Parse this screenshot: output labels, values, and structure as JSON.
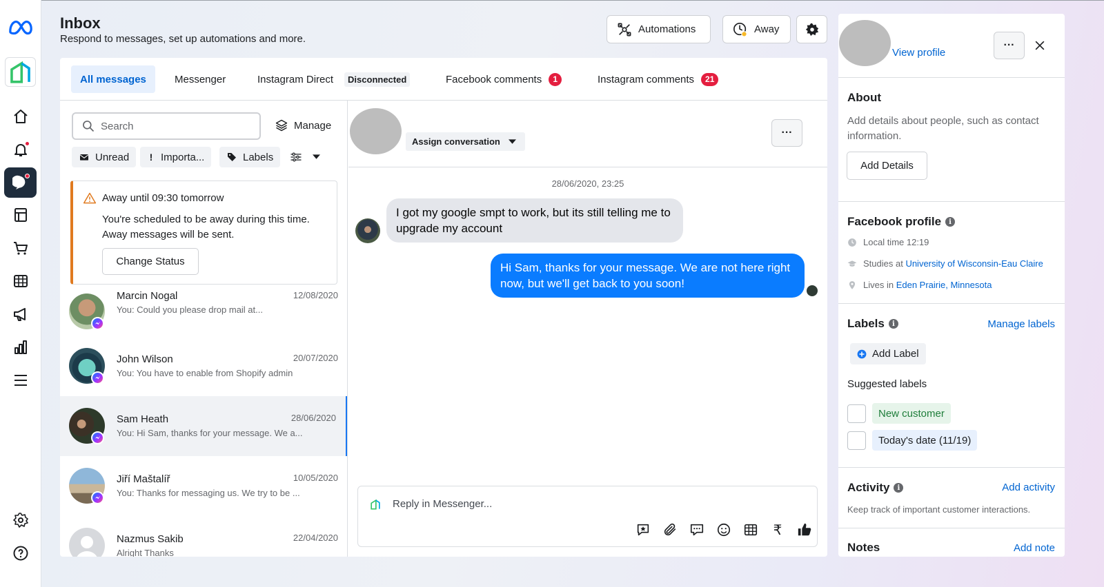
{
  "header": {
    "title": "Inbox",
    "subtitle": "Respond to messages, set up automations and more.",
    "automations_label": "Automations",
    "away_label": "Away"
  },
  "tabs": [
    {
      "label": "All messages",
      "active": true
    },
    {
      "label": "Messenger"
    },
    {
      "label": "Instagram Direct",
      "badge": "Disconnected"
    },
    {
      "label": "Facebook comments",
      "count": "1"
    },
    {
      "label": "Instagram comments",
      "count": "21"
    }
  ],
  "list": {
    "search_placeholder": "Search",
    "manage_label": "Manage",
    "filters": [
      "Unread",
      "Importa...",
      "Labels"
    ],
    "away_card": {
      "title": "Away until 09:30 tomorrow",
      "text": "You're scheduled to be away during this time. Away messages will be sent.",
      "button": "Change Status"
    },
    "conversations": [
      {
        "name": "Marcin Nogal",
        "preview": "You: Could you please drop mail at...",
        "date": "12/08/2020"
      },
      {
        "name": "John Wilson",
        "preview": "You: You have to enable from Shopify admin",
        "date": "20/07/2020"
      },
      {
        "name": "Sam Heath",
        "preview": "You: Hi Sam, thanks for your message. We a...",
        "date": "28/06/2020",
        "selected": true
      },
      {
        "name": "Jiří Maštalíř",
        "preview": "You: Thanks for messaging us. We try to be ...",
        "date": "10/05/2020"
      },
      {
        "name": "Nazmus Sakib",
        "preview": "Alright Thanks",
        "date": "22/04/2020"
      }
    ]
  },
  "conversation": {
    "assign_label": "Assign conversation",
    "timestamp": "28/06/2020, 23:25",
    "incoming": "I got my google smpt to work, but its still telling me to upgrade my account",
    "outgoing": "Hi Sam, thanks for your message. We are not here right now, but we'll get back to you soon!",
    "reply_placeholder": "Reply in Messenger..."
  },
  "profile": {
    "view_profile": "View profile",
    "about_title": "About",
    "about_text": "Add details about people, such as contact information.",
    "add_details": "Add Details",
    "fb_title": "Facebook profile",
    "local_time_label": "Local time 12:19",
    "studies_prefix": "Studies at ",
    "studies_value": "University of Wisconsin-Eau Claire",
    "lives_prefix": "Lives in ",
    "lives_value": "Eden Prairie, Minnesota",
    "labels_title": "Labels",
    "manage_labels": "Manage labels",
    "add_label": "Add Label",
    "suggested_title": "Suggested labels",
    "suggested": [
      "New customer",
      "Today's date (11/19)"
    ],
    "activity_title": "Activity",
    "add_activity": "Add activity",
    "activity_text": "Keep track of important customer interactions.",
    "notes_title": "Notes",
    "add_note": "Add note"
  },
  "colors": {
    "accent": "#0064d1",
    "bubble_out": "#0a7cff",
    "badge_red": "#e41e3f",
    "away_border": "#e07a1f"
  }
}
